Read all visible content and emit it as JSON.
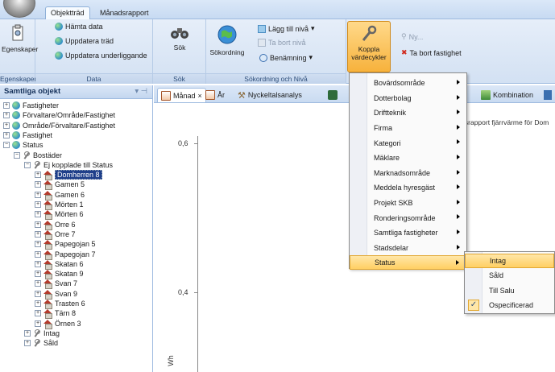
{
  "ribbon": {
    "tabs": [
      "Objektträd",
      "Månadsrapport"
    ],
    "groups": {
      "egenskaper": {
        "label": "Egenskaper",
        "button": "Egenskaper"
      },
      "data": {
        "label": "Data",
        "buttons": [
          "Hämta data",
          "Uppdatera träd",
          "Uppdatera underliggande"
        ]
      },
      "sok": {
        "label": "Sök",
        "button": "Sök"
      },
      "sokordning": {
        "label": "Sökordning och Nivå",
        "big_button": "Sökordning",
        "buttons": [
          "Lägg till nivå",
          "Ta bort nivå",
          "Benämning"
        ]
      },
      "koppla": {
        "line1": "Koppla",
        "line2": "värdecykler"
      },
      "fastighet": {
        "ny": "Ny...",
        "ta_bort": "Ta bort fastighet"
      }
    }
  },
  "left_panel": {
    "title": "Samtliga objekt",
    "pin_icons": "▾ ⊣",
    "tree": [
      {
        "label": "Fastigheter",
        "level": 0,
        "exp": "+",
        "icon": "globe"
      },
      {
        "label": "Förvaltare/Område/Fastighet",
        "level": 0,
        "exp": "+",
        "icon": "globe"
      },
      {
        "label": "Område/Förvaltare/Fastighet",
        "level": 0,
        "exp": "+",
        "icon": "globe"
      },
      {
        "label": "Fastighet",
        "level": 0,
        "exp": "+",
        "icon": "globe"
      },
      {
        "label": "Status",
        "level": 0,
        "exp": "−",
        "icon": "globe"
      },
      {
        "label": "Bostäder",
        "level": 1,
        "exp": "−",
        "icon": "wrench"
      },
      {
        "label": "Ej kopplade till Status",
        "level": 2,
        "exp": "−",
        "icon": "wrench"
      },
      {
        "label": "Domherren 8",
        "level": 3,
        "exp": "+",
        "icon": "house",
        "selected": true
      },
      {
        "label": "Gamen 5",
        "level": 3,
        "exp": "+",
        "icon": "house"
      },
      {
        "label": "Gamen 6",
        "level": 3,
        "exp": "+",
        "icon": "house"
      },
      {
        "label": "Mörten 1",
        "level": 3,
        "exp": "+",
        "icon": "house"
      },
      {
        "label": "Mörten 6",
        "level": 3,
        "exp": "+",
        "icon": "house"
      },
      {
        "label": "Orre 6",
        "level": 3,
        "exp": "+",
        "icon": "house"
      },
      {
        "label": "Orre 7",
        "level": 3,
        "exp": "+",
        "icon": "house"
      },
      {
        "label": "Papegojan 5",
        "level": 3,
        "exp": "+",
        "icon": "house"
      },
      {
        "label": "Papegojan 7",
        "level": 3,
        "exp": "+",
        "icon": "house"
      },
      {
        "label": "Skatan 6",
        "level": 3,
        "exp": "+",
        "icon": "house"
      },
      {
        "label": "Skatan 9",
        "level": 3,
        "exp": "+",
        "icon": "house"
      },
      {
        "label": "Svan 7",
        "level": 3,
        "exp": "+",
        "icon": "house"
      },
      {
        "label": "Svan 9",
        "level": 3,
        "exp": "+",
        "icon": "house"
      },
      {
        "label": "Trasten 6",
        "level": 3,
        "exp": "+",
        "icon": "house"
      },
      {
        "label": "Tärn 8",
        "level": 3,
        "exp": "+",
        "icon": "house"
      },
      {
        "label": "Örnen 3",
        "level": 3,
        "exp": "+",
        "icon": "house"
      },
      {
        "label": "Intag",
        "level": 2,
        "exp": "+",
        "icon": "wrench"
      },
      {
        "label": "Såld",
        "level": 2,
        "exp": "+",
        "icon": "wrench"
      }
    ]
  },
  "doc_tabs": [
    {
      "label": "Månad",
      "close": "×",
      "active": true
    },
    {
      "label": "År"
    },
    {
      "label": "Nyckeltalsanalys"
    },
    {
      "label": "Kombination"
    }
  ],
  "chart": {
    "subtitle": "lsrapport fjärrvärme  för Dom",
    "ytick_labels": [
      "0,6",
      "0,4"
    ],
    "ylabel_partial": "Wh"
  },
  "menu_main": {
    "items": [
      {
        "label": "Bovärdsområde",
        "submenu": true
      },
      {
        "label": "Dotterbolag",
        "submenu": true
      },
      {
        "label": "Driftteknik",
        "submenu": true
      },
      {
        "label": "Firma",
        "submenu": true
      },
      {
        "label": "Kategori",
        "submenu": true
      },
      {
        "label": "Mäklare",
        "submenu": true
      },
      {
        "label": "Marknadsområde",
        "submenu": true
      },
      {
        "label": "Meddela hyresgäst",
        "submenu": true
      },
      {
        "label": "Projekt SKB",
        "submenu": true
      },
      {
        "label": "Ronderingsområde",
        "submenu": true
      },
      {
        "label": "Samtliga fastigheter",
        "submenu": true
      },
      {
        "label": "Stadsdelar",
        "submenu": true
      },
      {
        "label": "Status",
        "submenu": true,
        "highlighted": true
      }
    ]
  },
  "menu_sub": {
    "items": [
      {
        "label": "Intag",
        "highlighted": true
      },
      {
        "label": "Såld"
      },
      {
        "label": "Till Salu"
      },
      {
        "label": "Ospecificerad",
        "checked": true
      }
    ],
    "check_glyph": "✓"
  }
}
